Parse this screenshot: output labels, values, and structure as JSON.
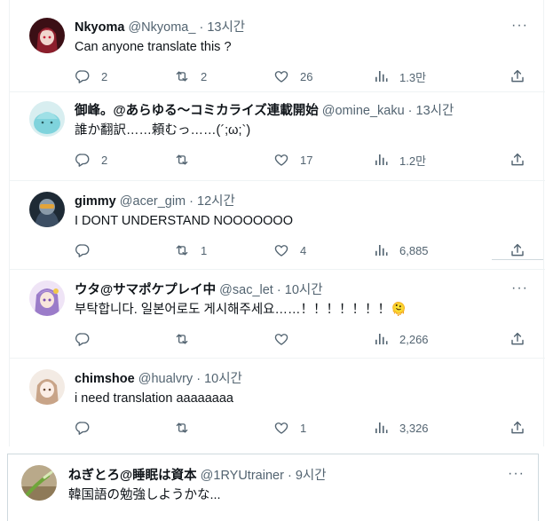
{
  "tweets": [
    {
      "name": "Nkyoma",
      "handle": "@Nkyoma_",
      "sep": "·",
      "time": "13시간",
      "text": "Can anyone translate this ?",
      "replies": "2",
      "retweets": "2",
      "likes": "26",
      "views": "1.3만"
    },
    {
      "name": "御峰。@あらゆる～コミカライズ連載開始",
      "handle": "@omine_kaku",
      "sep": "·",
      "time": "13시간",
      "text": "誰か翻訳……頼むっ……(´;ω;`)",
      "replies": "2",
      "retweets": "",
      "likes": "17",
      "views": "1.2만"
    },
    {
      "name": "gimmy",
      "handle": "@acer_gim",
      "sep": "·",
      "time": "12시간",
      "text": "I DONT UNDERSTAND NOOOOOOO",
      "replies": "",
      "retweets": "1",
      "likes": "4",
      "views": "6,885"
    },
    {
      "name": "ウタ@サマポケプレイ中",
      "handle": "@sac_let",
      "sep": "·",
      "time": "10시간",
      "text": "부탁합니다. 일본어로도 게시해주세요……！！！！！！！",
      "emoji": "🫠",
      "replies": "",
      "retweets": "",
      "likes": "",
      "views": "2,266"
    },
    {
      "name": "chimshoe",
      "handle": "@hualvry",
      "sep": "·",
      "time": "10시간",
      "text": "i need translation aaaaaaaa",
      "replies": "",
      "retweets": "",
      "likes": "1",
      "views": "3,326"
    }
  ],
  "quote": {
    "name": "ねぎとろ@睡眠は資本",
    "handle": "@1RYUtrainer",
    "sep": "·",
    "time": "9시간",
    "text": "韓国語の勉強しようかな..."
  },
  "colors": {
    "text": "#0f1419",
    "muted": "#536471",
    "border": "#eff3f4"
  }
}
